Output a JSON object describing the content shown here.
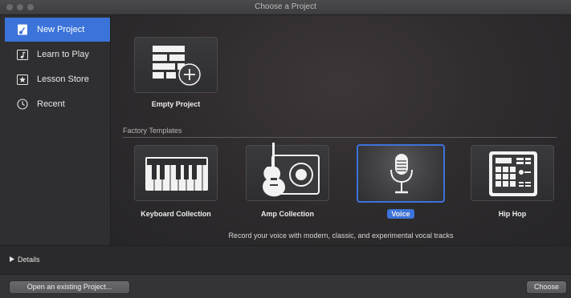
{
  "window": {
    "title": "Choose a Project"
  },
  "sidebar": {
    "items": [
      {
        "label": "New Project",
        "icon": "guitar-document-icon",
        "active": true
      },
      {
        "label": "Learn to Play",
        "icon": "music-note-icon",
        "active": false
      },
      {
        "label": "Lesson Store",
        "icon": "star-icon",
        "active": false
      },
      {
        "label": "Recent",
        "icon": "clock-icon",
        "active": false
      }
    ]
  },
  "main": {
    "empty_project": {
      "label": "Empty Project",
      "icon": "empty-project-add-icon"
    },
    "section_title": "Factory Templates",
    "templates": [
      {
        "label": "Keyboard Collection",
        "icon": "keyboard-icon",
        "selected": false
      },
      {
        "label": "Amp Collection",
        "icon": "guitar-amp-icon",
        "selected": false
      },
      {
        "label": "Voice",
        "icon": "microphone-icon",
        "selected": true
      },
      {
        "label": "Hip Hop",
        "icon": "drum-machine-icon",
        "selected": false
      }
    ],
    "description": "Record your voice with modern, classic, and experimental vocal tracks"
  },
  "details": {
    "label": "Details"
  },
  "footer": {
    "open_label": "Open an existing Project...",
    "choose_label": "Choose"
  },
  "colors": {
    "accent": "#3b73d9",
    "background": "#2b2b2d"
  }
}
